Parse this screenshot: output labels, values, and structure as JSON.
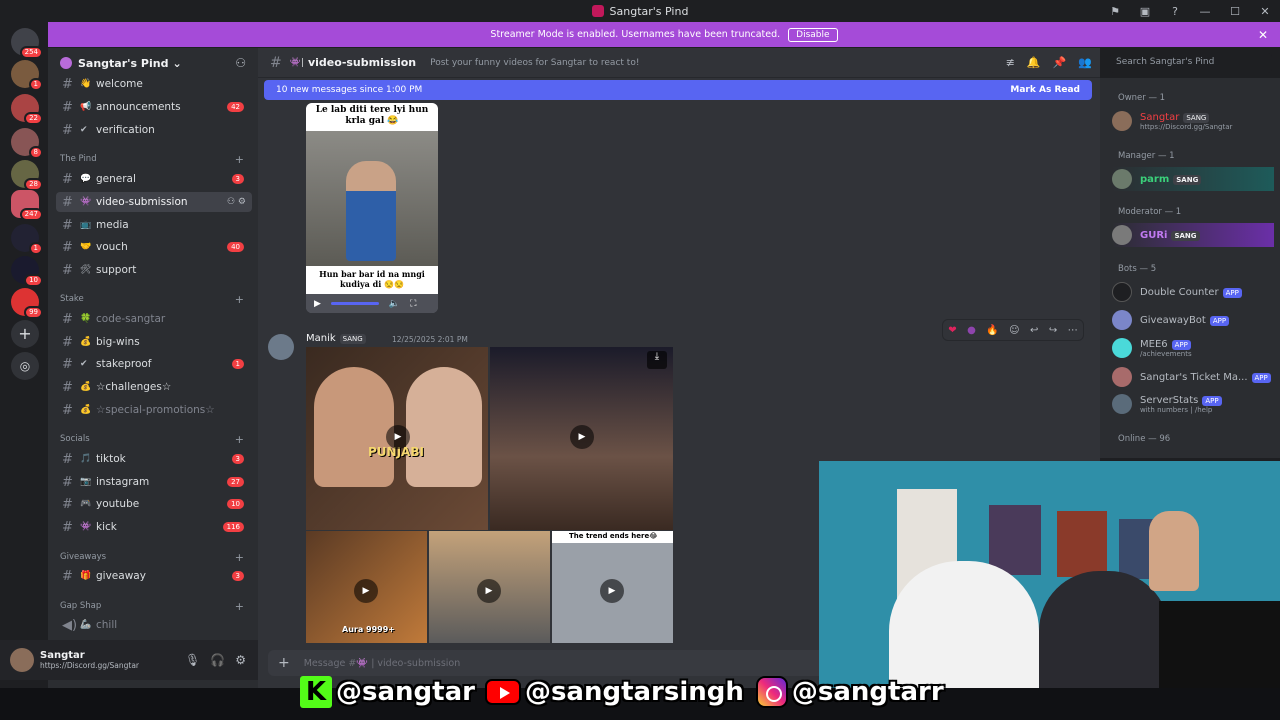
{
  "window": {
    "title": "Sangtar's Pind"
  },
  "banner": {
    "text": "Streamer Mode is enabled. Usernames have been truncated.",
    "disable_label": "Disable"
  },
  "server": {
    "name": "Sangtar's Pind"
  },
  "guild_badges": [
    "254",
    "1",
    "22",
    "8",
    "28",
    "247",
    "1",
    "10",
    "99"
  ],
  "channels": {
    "top": [
      {
        "emoji": "👋",
        "name": "welcome",
        "count": ""
      },
      {
        "emoji": "📢",
        "name": "announcements",
        "count": "42"
      },
      {
        "emoji": "✔",
        "name": "verification",
        "count": ""
      }
    ],
    "cat_pind": "The Pind",
    "pind": [
      {
        "emoji": "💬",
        "name": "general",
        "count": "3"
      },
      {
        "emoji": "👾",
        "name": "video-submission",
        "count": ""
      },
      {
        "emoji": "📺",
        "name": "media",
        "count": ""
      },
      {
        "emoji": "🤝",
        "name": "vouch",
        "count": "40"
      },
      {
        "emoji": "🛠",
        "name": "support",
        "count": ""
      }
    ],
    "cat_stake": "Stake",
    "stake": [
      {
        "emoji": "🍀",
        "name": "code-sangtar",
        "count": ""
      },
      {
        "emoji": "💰",
        "name": "big-wins",
        "count": ""
      },
      {
        "emoji": "✔",
        "name": "stakeproof",
        "count": "1"
      },
      {
        "emoji": "💰",
        "name": "☆challenges☆",
        "count": ""
      },
      {
        "emoji": "💰",
        "name": "☆special-promotions☆",
        "count": ""
      }
    ],
    "cat_socials": "Socials",
    "socials": [
      {
        "emoji": "🎵",
        "name": "tiktok",
        "count": "3"
      },
      {
        "emoji": "📷",
        "name": "instagram",
        "count": "27"
      },
      {
        "emoji": "🎮",
        "name": "youtube",
        "count": "10"
      },
      {
        "emoji": "👾",
        "name": "kick",
        "count": "116"
      }
    ],
    "cat_giveaways": "Giveaways",
    "giveaways": [
      {
        "emoji": "🎁",
        "name": "giveaway",
        "count": "3"
      }
    ],
    "cat_gapshap": "Gap Shap",
    "gapshap": [
      {
        "emoji": "🦾",
        "name": "chill",
        "count": ""
      }
    ]
  },
  "user": {
    "name": "Sangtar",
    "status": "https://Discord.gg/Sangtar"
  },
  "chat": {
    "channel": "video-submission",
    "topic": "Post your funny videos for Sangtar to react to!",
    "new_messages": "10 new messages since 1:00 PM",
    "mark_read": "Mark As Read",
    "search_placeholder": "Search Sangtar's Pind",
    "composer_placeholder": "Message #👾 | video-submission"
  },
  "media1": {
    "caption_top": "Le lab diti tere lyi hun krla gal 😂",
    "caption_bottom": "Hun bar bar id na mngi kudiya di 😒😒"
  },
  "message2": {
    "author": "Manik",
    "tag": "SANG",
    "timestamp": "12/25/2025 2:01 PM",
    "thumb_labels": [
      "PUNJABI",
      "The trend ends here😂",
      "Aura 9999+"
    ]
  },
  "members": {
    "owner_cat": "Owner — 1",
    "owner": {
      "name": "Sangtar",
      "tag": "SANG",
      "sub": "https://Discord.gg/Sangtar"
    },
    "manager_cat": "Manager — 1",
    "manager": {
      "name": "parm",
      "tag": "SANG"
    },
    "moderator_cat": "Moderator — 1",
    "moderator": {
      "name": "GURi",
      "tag": "SANG"
    },
    "bots_cat": "Bots — 5",
    "bots": [
      {
        "name": "Double Counter",
        "tag": "APP",
        "sub": ""
      },
      {
        "name": "GiveawayBot",
        "tag": "APP",
        "sub": ""
      },
      {
        "name": "MEE6",
        "tag": "APP",
        "sub": "/achievements"
      },
      {
        "name": "Sangtar's Ticket Ma...",
        "tag": "APP",
        "sub": ""
      },
      {
        "name": "ServerStats",
        "tag": "APP",
        "sub": "with numbers | /help"
      }
    ],
    "online_cat": "Online — 96"
  },
  "overlay": {
    "kick": "@sangtar",
    "youtube": "@sangtarsingh",
    "instagram": "@sangtarr"
  },
  "colors": {
    "blurple": "#5865f2",
    "banner": "#a54bd8",
    "badge_red": "#f23f43"
  }
}
